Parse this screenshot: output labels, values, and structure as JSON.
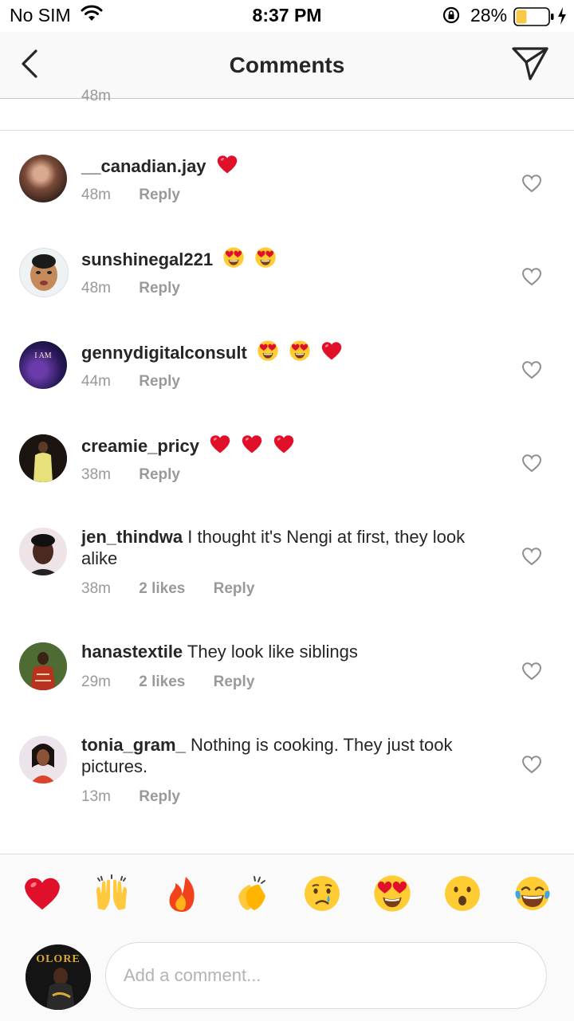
{
  "status_bar": {
    "carrier": "No SIM",
    "time": "8:37 PM",
    "battery_percent": "28%"
  },
  "nav": {
    "title": "Comments"
  },
  "partial_prev_time": "48m",
  "comments": [
    {
      "username": "__canadian.jay",
      "text": "",
      "emoji": [
        "heart"
      ],
      "time": "48m",
      "likes": "",
      "reply": "Reply"
    },
    {
      "username": "sunshinegal221",
      "text": "",
      "emoji": [
        "heart-eyes",
        "heart-eyes"
      ],
      "time": "48m",
      "likes": "",
      "reply": "Reply"
    },
    {
      "username": "gennydigitalconsult",
      "text": "",
      "emoji": [
        "heart-eyes",
        "heart-eyes",
        "heart"
      ],
      "time": "44m",
      "likes": "",
      "reply": "Reply"
    },
    {
      "username": "creamie_pricy",
      "text": "",
      "emoji": [
        "heart",
        "heart",
        "heart"
      ],
      "time": "38m",
      "likes": "",
      "reply": "Reply"
    },
    {
      "username": "jen_thindwa",
      "text": "I thought it's Nengi at first, they look alike",
      "emoji": [],
      "time": "38m",
      "likes": "2 likes",
      "reply": "Reply"
    },
    {
      "username": "hanastextile",
      "text": "They look like siblings",
      "emoji": [],
      "time": "29m",
      "likes": "2 likes",
      "reply": "Reply"
    },
    {
      "username": "tonia_gram_",
      "text": "Nothing is cooking. They just took pictures.",
      "emoji": [],
      "time": "13m",
      "likes": "",
      "reply": "Reply"
    }
  ],
  "quick_reactions": [
    "heart",
    "raising-hands",
    "fire",
    "clapping-hands",
    "crying-face",
    "heart-eyes",
    "surprised-face",
    "tears-of-joy"
  ],
  "composer": {
    "placeholder": "Add a comment..."
  },
  "colors": {
    "text": "#262626",
    "secondary": "#8e8e8e",
    "heart_red": "#e0102a",
    "battery_yellow": "#f7c948"
  }
}
